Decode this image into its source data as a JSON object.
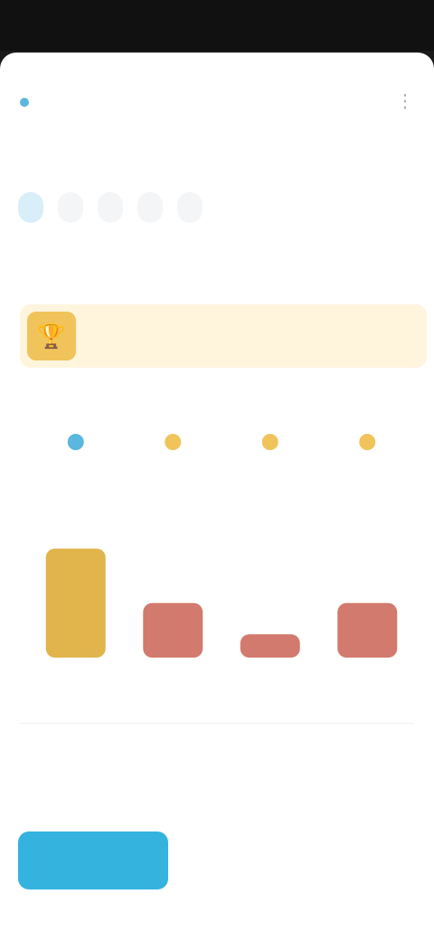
{
  "status": {
    "time": "",
    "indicators": ""
  },
  "header": {
    "title": "",
    "subtitle": "",
    "subtitle2": ""
  },
  "tabs": [
    {
      "label": "",
      "active": true
    },
    {
      "label": "",
      "active": false
    },
    {
      "label": "",
      "active": false
    },
    {
      "label": "",
      "active": false
    },
    {
      "label": "",
      "active": false
    }
  ],
  "section": {
    "title": "",
    "link": ""
  },
  "banner": {
    "text": ""
  },
  "chart_data": {
    "type": "bar",
    "categories": [
      "",
      "",
      "",
      ""
    ],
    "values": [
      7,
      3.5,
      1.5,
      3.5
    ],
    "ylim": [
      0,
      10
    ],
    "colors": [
      "#e1b44c",
      "#d27a6d",
      "#d27a6d",
      "#d27a6d"
    ],
    "header_icon_colors": [
      "#5bb7df",
      "#f0c45a",
      "#f0c45a",
      "#f0c45a"
    ],
    "grid": false
  },
  "bottom": {
    "title": "",
    "subtitle": "",
    "primary_button": "",
    "options": [
      "",
      "",
      ""
    ]
  },
  "colors": {
    "accent": "#34b3df",
    "banner_bg": "#fff5dd",
    "banner_icon": "#f0c45a"
  },
  "icons": {
    "menu": "more-vertical-icon",
    "banner": "trophy-icon",
    "chart_header": "star-icon"
  }
}
